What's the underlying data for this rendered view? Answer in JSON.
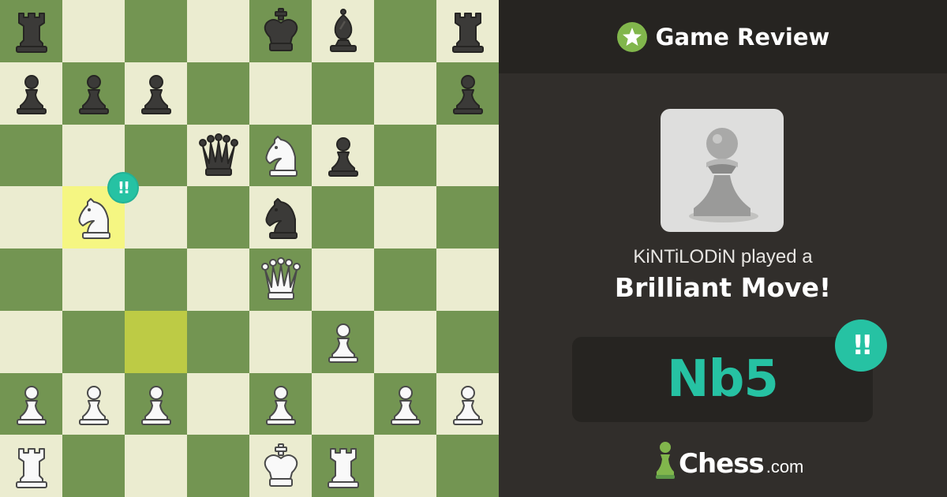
{
  "header": {
    "title": "Game Review",
    "icon": "star-icon",
    "icon_color": "#81b64c"
  },
  "board": {
    "light_color": "#ebecd0",
    "dark_color": "#739552",
    "highlight_to_color": "#f5f682",
    "highlight_from_color": "#bdcb45",
    "highlight_to": "b5",
    "highlight_from": "c3",
    "badge_square": "b5",
    "badge_text": "!!",
    "pieces": [
      {
        "square": "a8",
        "piece": "rook",
        "color": "black"
      },
      {
        "square": "e8",
        "piece": "king",
        "color": "black"
      },
      {
        "square": "f8",
        "piece": "bishop",
        "color": "black"
      },
      {
        "square": "h8",
        "piece": "rook",
        "color": "black"
      },
      {
        "square": "a7",
        "piece": "pawn",
        "color": "black"
      },
      {
        "square": "b7",
        "piece": "pawn",
        "color": "black"
      },
      {
        "square": "c7",
        "piece": "pawn",
        "color": "black"
      },
      {
        "square": "h7",
        "piece": "pawn",
        "color": "black"
      },
      {
        "square": "d6",
        "piece": "queen",
        "color": "black"
      },
      {
        "square": "e6",
        "piece": "knight",
        "color": "white"
      },
      {
        "square": "f6",
        "piece": "pawn",
        "color": "black"
      },
      {
        "square": "b5",
        "piece": "knight",
        "color": "white"
      },
      {
        "square": "e5",
        "piece": "knight",
        "color": "black"
      },
      {
        "square": "e4",
        "piece": "queen",
        "color": "white"
      },
      {
        "square": "f3",
        "piece": "pawn",
        "color": "white"
      },
      {
        "square": "a2",
        "piece": "pawn",
        "color": "white"
      },
      {
        "square": "b2",
        "piece": "pawn",
        "color": "white"
      },
      {
        "square": "c2",
        "piece": "pawn",
        "color": "white"
      },
      {
        "square": "e2",
        "piece": "pawn",
        "color": "white"
      },
      {
        "square": "g2",
        "piece": "pawn",
        "color": "white"
      },
      {
        "square": "h2",
        "piece": "pawn",
        "color": "white"
      },
      {
        "square": "a1",
        "piece": "rook",
        "color": "white"
      },
      {
        "square": "e1",
        "piece": "king",
        "color": "white"
      },
      {
        "square": "f1",
        "piece": "rook",
        "color": "white"
      }
    ]
  },
  "review": {
    "piece_icon": "pawn-icon",
    "player_line": "KiNTiLODiN played a",
    "classification": "Brilliant Move!",
    "move": "Nb5",
    "move_badge": "!!",
    "accent_color": "#26c2a3"
  },
  "logo": {
    "word": "Chess",
    "domain": ".com",
    "icon": "pawn-logo-icon"
  }
}
